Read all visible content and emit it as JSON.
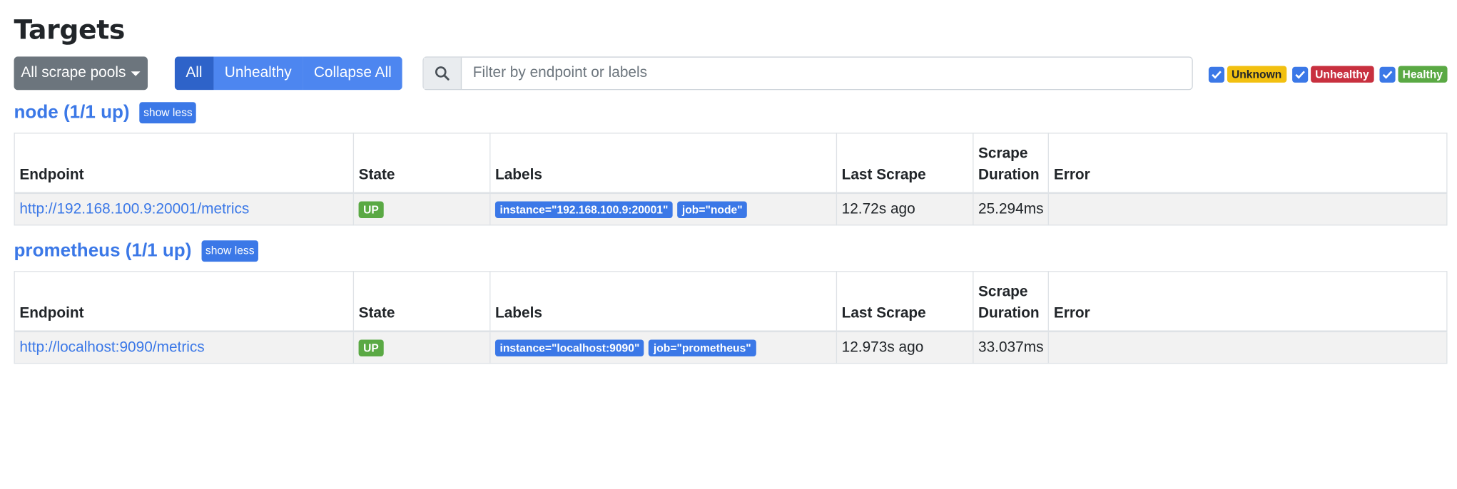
{
  "page": {
    "title": "Targets"
  },
  "toolbar": {
    "pools_button": "All scrape pools",
    "buttons": [
      {
        "label": "All",
        "active": true
      },
      {
        "label": "Unhealthy",
        "active": false
      },
      {
        "label": "Collapse All",
        "active": false
      }
    ],
    "search_placeholder": "Filter by endpoint or labels",
    "search_icon": "search-icon",
    "filters": [
      {
        "label": "Unknown",
        "checked": true,
        "color": "#f2c010"
      },
      {
        "label": "Unhealthy",
        "checked": true,
        "color": "#c8303f"
      },
      {
        "label": "Healthy",
        "checked": true,
        "color": "#5aa944"
      }
    ]
  },
  "columns": {
    "endpoint": "Endpoint",
    "state": "State",
    "labels": "Labels",
    "last_scrape": "Last Scrape",
    "scrape_duration_line1": "Scrape",
    "scrape_duration_line2": "Duration",
    "error": "Error"
  },
  "pools": [
    {
      "name": "node (1/1 up)",
      "toggle": "show less",
      "targets": [
        {
          "endpoint": "http://192.168.100.9:20001/metrics",
          "state": "UP",
          "labels": [
            "instance=\"192.168.100.9:20001\"",
            "job=\"node\""
          ],
          "last_scrape": "12.72s ago",
          "scrape_duration": "25.294ms",
          "error": ""
        }
      ]
    },
    {
      "name": "prometheus (1/1 up)",
      "toggle": "show less",
      "targets": [
        {
          "endpoint": "http://localhost:9090/metrics",
          "state": "UP",
          "labels": [
            "instance=\"localhost:9090\"",
            "job=\"prometheus\""
          ],
          "last_scrape": "12.973s ago",
          "scrape_duration": "33.037ms",
          "error": ""
        }
      ]
    }
  ],
  "colors": {
    "primary": "#3b78e7",
    "up": "#5aa944",
    "secondary": "#6c757d"
  }
}
